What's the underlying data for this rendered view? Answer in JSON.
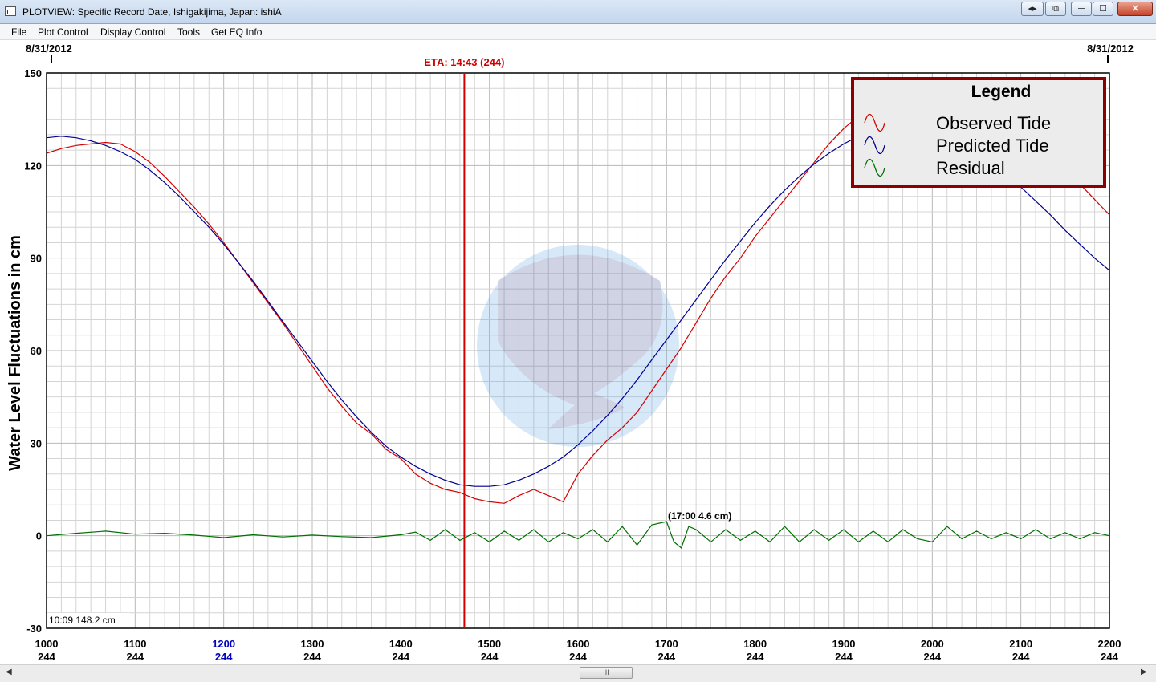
{
  "window": {
    "title": "PLOTVIEW: Specific Record Date, Ishigakijima, Japan: ishiA",
    "buttons": [
      "◂▸",
      "⧉",
      "─",
      "☐",
      "✕"
    ]
  },
  "menu": [
    "File",
    "Plot Control",
    "Display Control",
    "Tools",
    "Get EQ Info"
  ],
  "plot": {
    "date_left": "8/31/2012",
    "date_right": "8/31/2012",
    "eta_label": "ETA: 14:43 (244)",
    "cursor_readout": "10:09 148.2 cm",
    "peak_annotation": "(17:00   4.6 cm)",
    "scroll_thumb": "III"
  },
  "colors": {
    "observed": "#d40000",
    "predicted": "#000090",
    "residual": "#007000",
    "eta_line": "#d40000",
    "legend_border": "#8b0000",
    "highlight_tick": "#0000c0"
  },
  "legend": {
    "title": "Legend",
    "items": [
      "Observed Tide",
      "Predicted Tide",
      "Residual"
    ]
  },
  "chart_data": {
    "type": "line",
    "ylabel": "Water Level Fluctuations in cm",
    "xlabel": "",
    "ylim": [
      -30,
      150
    ],
    "xlim": [
      1000,
      2200
    ],
    "y_ticks": [
      150,
      120,
      90,
      60,
      30,
      0,
      -30
    ],
    "x_ticks": [
      {
        "time": "1000",
        "day": "244"
      },
      {
        "time": "1100",
        "day": "244"
      },
      {
        "time": "1200",
        "day": "244"
      },
      {
        "time": "1300",
        "day": "244"
      },
      {
        "time": "1400",
        "day": "244"
      },
      {
        "time": "1500",
        "day": "244"
      },
      {
        "time": "1600",
        "day": "244"
      },
      {
        "time": "1700",
        "day": "244"
      },
      {
        "time": "1800",
        "day": "244"
      },
      {
        "time": "1900",
        "day": "244"
      },
      {
        "time": "2000",
        "day": "244"
      },
      {
        "time": "2100",
        "day": "244"
      },
      {
        "time": "2200",
        "day": "244"
      }
    ],
    "highlight_tick": "1200",
    "eta_x": 1443,
    "grid": true,
    "legend_position": "top-right",
    "series": [
      {
        "name": "Observed Tide",
        "points": [
          [
            1000,
            124
          ],
          [
            1010,
            125.5
          ],
          [
            1020,
            126.5
          ],
          [
            1030,
            127
          ],
          [
            1040,
            127.5
          ],
          [
            1050,
            127
          ],
          [
            1100,
            124.5
          ],
          [
            1110,
            121
          ],
          [
            1120,
            116.5
          ],
          [
            1130,
            111.5
          ],
          [
            1140,
            106.5
          ],
          [
            1150,
            101
          ],
          [
            1200,
            95
          ],
          [
            1210,
            88.5
          ],
          [
            1220,
            82
          ],
          [
            1230,
            75.5
          ],
          [
            1240,
            69
          ],
          [
            1250,
            62
          ],
          [
            1300,
            55
          ],
          [
            1310,
            48
          ],
          [
            1320,
            42
          ],
          [
            1330,
            36.5
          ],
          [
            1340,
            33
          ],
          [
            1350,
            28
          ],
          [
            1400,
            25
          ],
          [
            1410,
            20
          ],
          [
            1420,
            17
          ],
          [
            1430,
            15
          ],
          [
            1440,
            14
          ],
          [
            1450,
            12
          ],
          [
            1500,
            11
          ],
          [
            1510,
            10.5
          ],
          [
            1520,
            13
          ],
          [
            1530,
            15
          ],
          [
            1540,
            13
          ],
          [
            1550,
            11
          ],
          [
            1600,
            20
          ],
          [
            1610,
            26
          ],
          [
            1620,
            31
          ],
          [
            1630,
            35
          ],
          [
            1640,
            40
          ],
          [
            1650,
            47
          ],
          [
            1700,
            54
          ],
          [
            1710,
            61
          ],
          [
            1720,
            69
          ],
          [
            1730,
            77
          ],
          [
            1740,
            84
          ],
          [
            1750,
            90
          ],
          [
            1800,
            97
          ],
          [
            1810,
            103
          ],
          [
            1820,
            109
          ],
          [
            1830,
            115
          ],
          [
            1840,
            121
          ],
          [
            1850,
            127
          ],
          [
            1900,
            132
          ],
          [
            1910,
            136
          ],
          [
            1920,
            139
          ],
          [
            1930,
            142
          ],
          [
            1940,
            144
          ],
          [
            1950,
            145
          ],
          [
            2000,
            146
          ],
          [
            2010,
            146.5
          ],
          [
            2020,
            145
          ],
          [
            2030,
            143
          ],
          [
            2040,
            140
          ],
          [
            2050,
            137
          ],
          [
            2100,
            133
          ],
          [
            2110,
            128
          ],
          [
            2120,
            124
          ],
          [
            2130,
            119
          ],
          [
            2140,
            114
          ],
          [
            2150,
            109
          ],
          [
            2200,
            104
          ]
        ]
      },
      {
        "name": "Predicted Tide",
        "points": [
          [
            1000,
            129
          ],
          [
            1010,
            129.5
          ],
          [
            1020,
            129
          ],
          [
            1030,
            128
          ],
          [
            1040,
            126.5
          ],
          [
            1050,
            124.5
          ],
          [
            1100,
            122
          ],
          [
            1110,
            118.5
          ],
          [
            1120,
            114.5
          ],
          [
            1130,
            110
          ],
          [
            1140,
            105
          ],
          [
            1150,
            100
          ],
          [
            1200,
            94.5
          ],
          [
            1210,
            88.5
          ],
          [
            1220,
            82.5
          ],
          [
            1230,
            76
          ],
          [
            1240,
            69.5
          ],
          [
            1250,
            63
          ],
          [
            1300,
            56.5
          ],
          [
            1310,
            50
          ],
          [
            1320,
            44
          ],
          [
            1330,
            38.5
          ],
          [
            1340,
            33.5
          ],
          [
            1350,
            29
          ],
          [
            1400,
            25.5
          ],
          [
            1410,
            22.5
          ],
          [
            1420,
            20
          ],
          [
            1430,
            18
          ],
          [
            1440,
            16.5
          ],
          [
            1450,
            16
          ],
          [
            1500,
            16
          ],
          [
            1510,
            16.5
          ],
          [
            1520,
            18
          ],
          [
            1530,
            20
          ],
          [
            1540,
            22.5
          ],
          [
            1550,
            25.5
          ],
          [
            1600,
            29.5
          ],
          [
            1610,
            34
          ],
          [
            1620,
            39
          ],
          [
            1630,
            44.5
          ],
          [
            1640,
            50.5
          ],
          [
            1650,
            57
          ],
          [
            1700,
            63.5
          ],
          [
            1710,
            70
          ],
          [
            1720,
            76.5
          ],
          [
            1730,
            83
          ],
          [
            1740,
            89.5
          ],
          [
            1750,
            95.5
          ],
          [
            1800,
            101.5
          ],
          [
            1810,
            107
          ],
          [
            1820,
            112
          ],
          [
            1830,
            116.5
          ],
          [
            1840,
            120.5
          ],
          [
            1850,
            124
          ],
          [
            1900,
            127
          ],
          [
            1910,
            129.5
          ],
          [
            1920,
            131
          ],
          [
            1930,
            132
          ],
          [
            1940,
            132.5
          ],
          [
            1950,
            132.5
          ],
          [
            2000,
            131.5
          ],
          [
            2010,
            130
          ],
          [
            2020,
            128
          ],
          [
            2030,
            125
          ],
          [
            2040,
            121.5
          ],
          [
            2050,
            117.5
          ],
          [
            2100,
            113
          ],
          [
            2110,
            108.5
          ],
          [
            2120,
            104
          ],
          [
            2130,
            99
          ],
          [
            2140,
            94.5
          ],
          [
            2150,
            90
          ],
          [
            2200,
            86
          ]
        ]
      },
      {
        "name": "Residual",
        "points": [
          [
            1000,
            0
          ],
          [
            1020,
            0.8
          ],
          [
            1040,
            1.5
          ],
          [
            1100,
            0.5
          ],
          [
            1120,
            0.8
          ],
          [
            1140,
            0.2
          ],
          [
            1200,
            -0.6
          ],
          [
            1220,
            0.3
          ],
          [
            1240,
            -0.4
          ],
          [
            1300,
            0.2
          ],
          [
            1320,
            -0.3
          ],
          [
            1340,
            -0.6
          ],
          [
            1400,
            0.3
          ],
          [
            1410,
            1.2
          ],
          [
            1420,
            -1.5
          ],
          [
            1430,
            2
          ],
          [
            1440,
            -1.5
          ],
          [
            1450,
            1
          ],
          [
            1500,
            -2
          ],
          [
            1510,
            1.5
          ],
          [
            1520,
            -1.5
          ],
          [
            1530,
            2
          ],
          [
            1540,
            -2
          ],
          [
            1550,
            1
          ],
          [
            1600,
            -1
          ],
          [
            1610,
            2
          ],
          [
            1620,
            -2
          ],
          [
            1630,
            3
          ],
          [
            1640,
            -3
          ],
          [
            1650,
            3.5
          ],
          [
            1700,
            4.6
          ],
          [
            1705,
            -2
          ],
          [
            1710,
            -4
          ],
          [
            1715,
            3
          ],
          [
            1720,
            2
          ],
          [
            1730,
            -2
          ],
          [
            1740,
            2
          ],
          [
            1750,
            -1.5
          ],
          [
            1800,
            1.5
          ],
          [
            1810,
            -2
          ],
          [
            1820,
            3
          ],
          [
            1830,
            -2
          ],
          [
            1840,
            2
          ],
          [
            1850,
            -1.5
          ],
          [
            1900,
            2
          ],
          [
            1910,
            -2
          ],
          [
            1920,
            1.5
          ],
          [
            1930,
            -2
          ],
          [
            1940,
            2
          ],
          [
            1950,
            -1
          ],
          [
            2000,
            -2
          ],
          [
            2010,
            3
          ],
          [
            2020,
            -1
          ],
          [
            2030,
            1.5
          ],
          [
            2040,
            -1
          ],
          [
            2050,
            1
          ],
          [
            2100,
            -1
          ],
          [
            2110,
            2
          ],
          [
            2120,
            -1
          ],
          [
            2130,
            1
          ],
          [
            2140,
            -1
          ],
          [
            2150,
            1
          ],
          [
            2200,
            0
          ]
        ]
      }
    ]
  }
}
